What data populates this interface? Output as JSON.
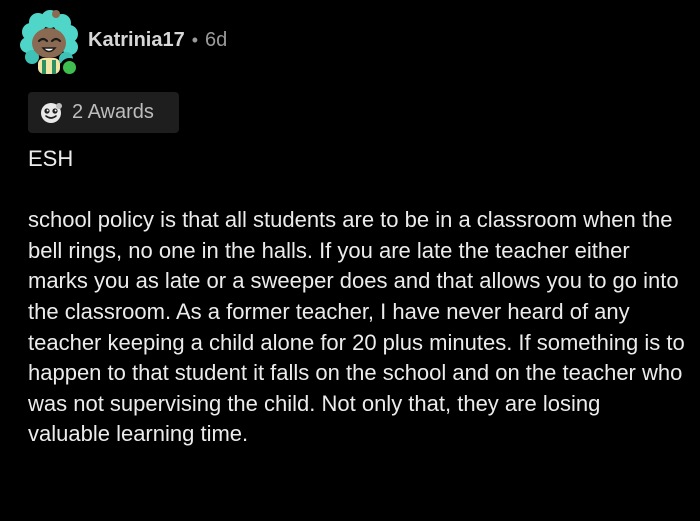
{
  "comment": {
    "author": {
      "username": "Katrinia17",
      "separator": "•",
      "age": "6d",
      "avatar_icon": "snoo-avatar-icon",
      "online": true
    },
    "awards": {
      "icon": "award-icon",
      "label": "2 Awards"
    },
    "body": {
      "verdict": "ESH",
      "paragraph": "school policy is that all students are to be in a classroom when the bell rings, no one in the halls. If you are late the teacher either marks you as late or a sweeper does and that allows you to go into the classroom. As a former teacher, I have never heard of any teacher keeping a child alone for 20 plus minutes. If something is to happen to that student it falls on the school and on the teacher who was not supervising the child.  Not only that,  they are losing valuable learning time."
    }
  },
  "colors": {
    "background": "#000000",
    "text": "#ececec",
    "muted": "#9a9a9a",
    "award_bg": "#1e1e1e",
    "avatar_hair": "#4fd6c8",
    "avatar_skin": "#8a6a52",
    "online": "#3fbf4f"
  }
}
